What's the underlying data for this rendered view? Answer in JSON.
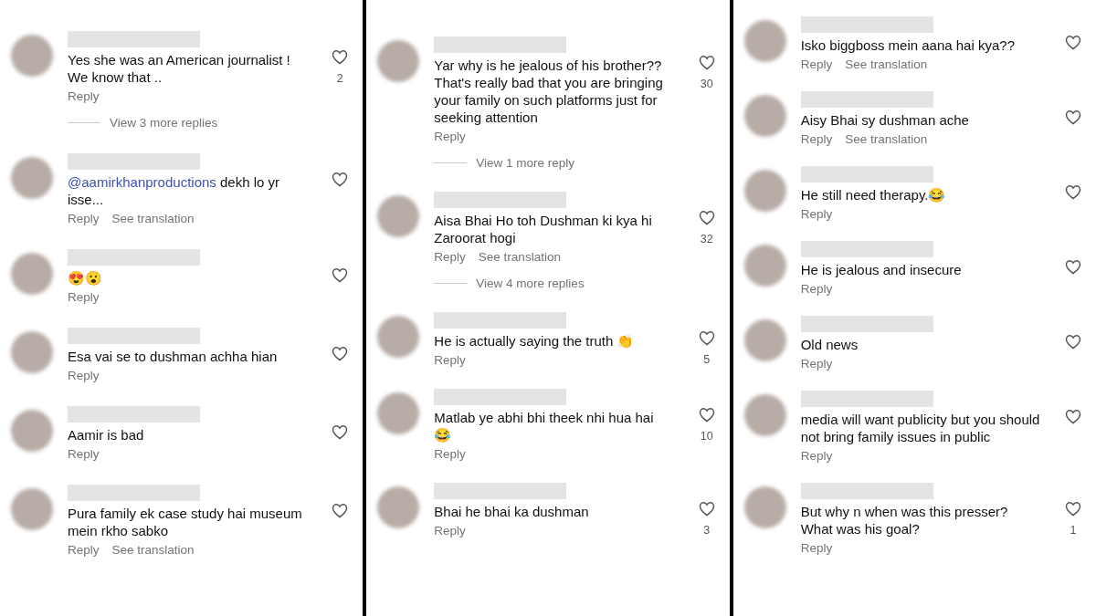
{
  "panels": [
    {
      "comments": [
        {
          "text": "Yes she was an American journalist ! We know that ..",
          "reply": "Reply",
          "likes": "2",
          "view_replies": "View 3 more replies"
        },
        {
          "mention": "@aamirkhanproductions",
          "text": " dekh lo yr isse...",
          "reply": "Reply",
          "translation": "See translation"
        },
        {
          "text": "😍😮",
          "reply": "Reply"
        },
        {
          "text": "Esa vai se to dushman achha hian",
          "reply": "Reply"
        },
        {
          "text": "Aamir is bad",
          "reply": "Reply"
        },
        {
          "text": "Pura family ek case study hai museum mein rkho sabko",
          "reply": "Reply",
          "translation": "See translation"
        }
      ]
    },
    {
      "comments": [
        {
          "text": "Yar why is he jealous of his brother?? That's really bad that you are bringing your family on such platforms just for seeking attention",
          "reply": "Reply",
          "likes": "30",
          "view_replies": "View 1 more reply"
        },
        {
          "text": "Aisa Bhai Ho toh Dushman ki kya hi Zaroorat hogi",
          "reply": "Reply",
          "translation": "See translation",
          "likes": "32",
          "view_replies": "View 4 more replies"
        },
        {
          "text": "He is actually saying the truth 👏",
          "reply": "Reply",
          "likes": "5"
        },
        {
          "text": "Matlab ye abhi bhi theek nhi hua hai 😂",
          "reply": "Reply",
          "likes": "10"
        },
        {
          "text": "Bhai he bhai ka dushman",
          "reply": "Reply",
          "likes": "3"
        }
      ]
    },
    {
      "comments": [
        {
          "text": "Isko biggboss mein aana hai kya??",
          "reply": "Reply",
          "translation": "See translation"
        },
        {
          "text": "Aisy Bhai sy dushman ache",
          "reply": "Reply",
          "translation": "See translation"
        },
        {
          "text": "He still need therapy.😂",
          "reply": "Reply"
        },
        {
          "text": "He is jealous and insecure",
          "reply": "Reply"
        },
        {
          "text": "Old news",
          "reply": "Reply"
        },
        {
          "text": "media will want publicity but you should not bring family issues in public",
          "reply": "Reply"
        },
        {
          "text": "But why n when was this presser? What was his goal?",
          "reply": "Reply",
          "likes": "1"
        }
      ]
    }
  ]
}
